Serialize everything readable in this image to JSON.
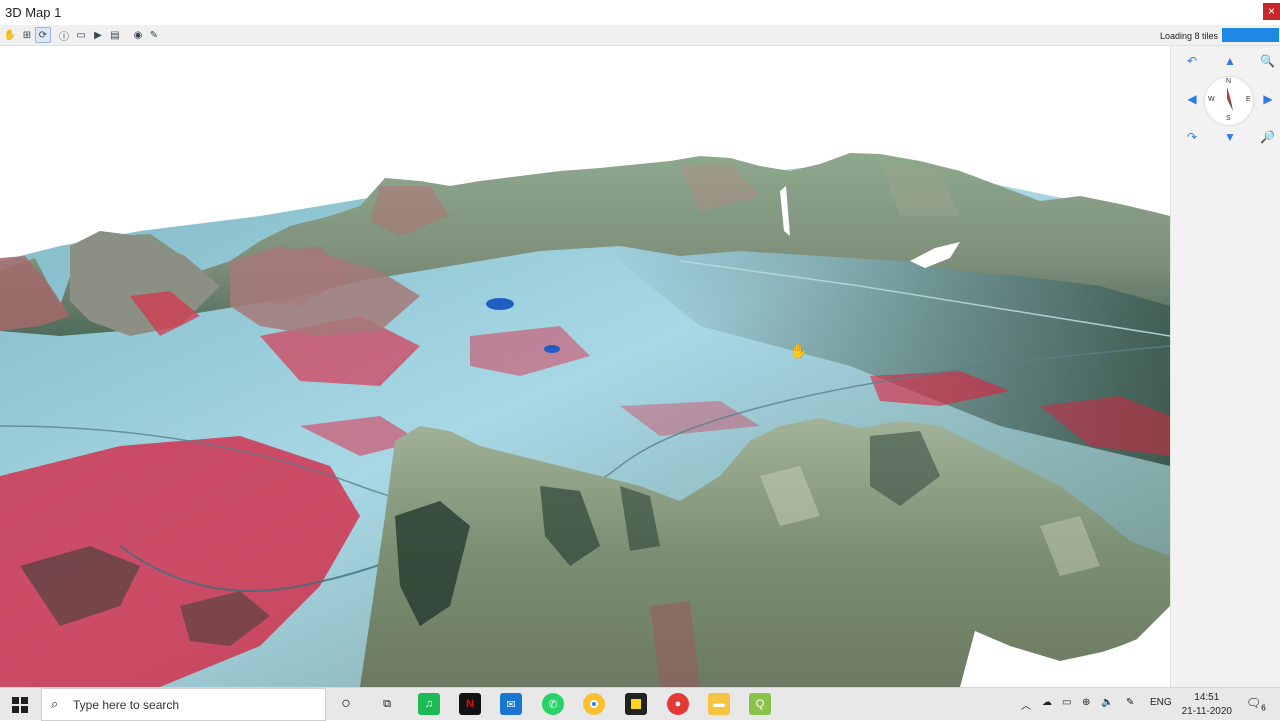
{
  "window": {
    "title": "3D Map 1",
    "close_label": "×"
  },
  "toolbar": {
    "buttons": [
      "pan-tool",
      "zoom-extent",
      "rotate-tool",
      "identify-tool",
      "measure-tool",
      "animation-play",
      "export-image",
      "camera-settings",
      "options-tool"
    ],
    "status_text": "Loading 8 tiles",
    "loading_progress": 1.0,
    "accent": "#1e88e5"
  },
  "navigation": {
    "compass_n": "N",
    "compass_s": "S",
    "compass_e": "E",
    "compass_w": "W",
    "arrow_color": "#2d7be5"
  },
  "taskbar": {
    "search_placeholder": "Type here to search",
    "apps": [
      "cortana",
      "task-view",
      "spotify",
      "netflix",
      "mail",
      "whatsapp",
      "chrome",
      "sticky-notes",
      "screen-recorder",
      "file-explorer",
      "qgis"
    ],
    "language": "ENG",
    "time": "14:51",
    "date": "21-11-2020",
    "notification_count": "6"
  }
}
